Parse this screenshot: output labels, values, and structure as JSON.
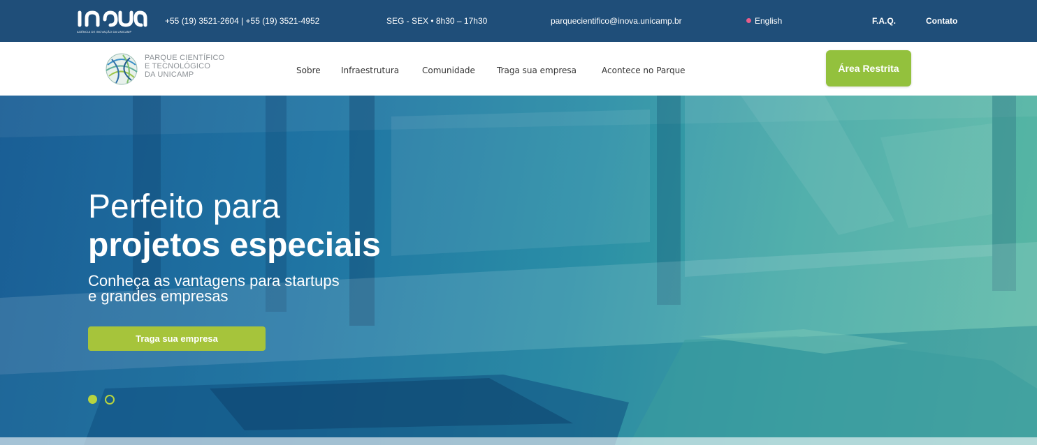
{
  "topbar": {
    "logo_text": "inova",
    "logo_tagline": "AGÊNCIA DE INOVAÇÃO DA UNICAMP",
    "phones": "+55 (19) 3521-2604 | +55 (19) 3521-4952",
    "hours": "SEG - SEX • 8h30 – 17h30",
    "email": "parquecientifico@inova.unicamp.br",
    "language": "English",
    "faq": "F.A.Q.",
    "contact": "Contato",
    "background_color": "#1f4e79"
  },
  "navbar": {
    "park_name_lines": [
      "PARQUE CIENTÍFICO",
      "E TECNOLÓGICO",
      "DA UNICAMP"
    ],
    "links": [
      "Sobre",
      "Infraestrutura",
      "Comunidade",
      "Traga sua empresa",
      "Acontece no Parque"
    ],
    "restricted_button": "Área Restrita",
    "accent_color": "#93c13d"
  },
  "hero": {
    "title_light": "Perfeito para",
    "title_bold": "projetos especiais",
    "subtitle_line1": "Conheça as vantagens para startups",
    "subtitle_line2": "e grandes empresas",
    "cta": "Traga sua empresa",
    "slides_total": 2,
    "slide_active": 1
  }
}
